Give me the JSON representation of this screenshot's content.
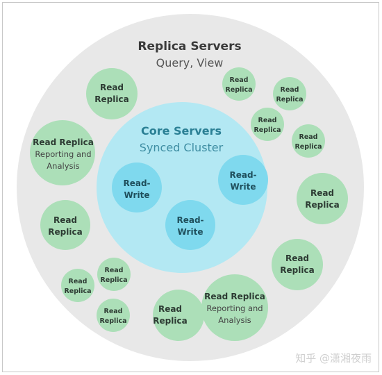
{
  "replica": {
    "title": "Replica Servers",
    "subtitle": "Query, View"
  },
  "core": {
    "title": "Core Servers",
    "subtitle": "Synced Cluster"
  },
  "node": {
    "read": "Read",
    "replica": "Replica",
    "read_replica": "Read Replica",
    "reporting": "Reporting and",
    "analysis": "Analysis",
    "rw1": "Read-",
    "rw2": "Write"
  },
  "watermark": "知乎 @潇湘夜雨",
  "colors": {
    "outer": "#e8e8e8",
    "core": "#b3e8f3",
    "read_write": "#7fd9ee",
    "replica": "#acdfb8"
  }
}
